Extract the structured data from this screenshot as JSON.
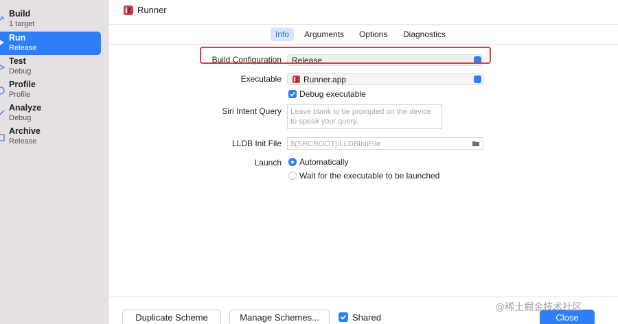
{
  "sidebar": {
    "items": [
      {
        "title": "Build",
        "subtitle": "1 target"
      },
      {
        "title": "Run",
        "subtitle": "Release"
      },
      {
        "title": "Test",
        "subtitle": "Debug"
      },
      {
        "title": "Profile",
        "subtitle": "Profile"
      },
      {
        "title": "Analyze",
        "subtitle": "Debug"
      },
      {
        "title": "Archive",
        "subtitle": "Release"
      }
    ]
  },
  "window": {
    "title": "Runner"
  },
  "tabs": [
    {
      "label": "Info"
    },
    {
      "label": "Arguments"
    },
    {
      "label": "Options"
    },
    {
      "label": "Diagnostics"
    }
  ],
  "form": {
    "build_configuration": {
      "label": "Build Configuration",
      "value": "Release"
    },
    "executable": {
      "label": "Executable",
      "value": "Runner.app"
    },
    "debug_executable": {
      "label": "Debug executable",
      "checked": true
    },
    "siri_intent_query": {
      "label": "Siri Intent Query",
      "placeholder": "Leave blank to be prompted on the device to speak your query."
    },
    "lldb_init_file": {
      "label": "LLDB Init File",
      "placeholder": "$(SRCROOT)/LLDBInitFile"
    },
    "launch": {
      "label": "Launch",
      "options": [
        {
          "label": "Automatically",
          "selected": true
        },
        {
          "label": "Wait for the executable to be launched",
          "selected": false
        }
      ]
    }
  },
  "footer": {
    "duplicate_label": "Duplicate Scheme",
    "manage_label": "Manage Schemes...",
    "shared_label": "Shared",
    "close_label": "Close"
  },
  "watermark": "@稀土掘金技术社区",
  "colors": {
    "accent": "#2e7ff6",
    "highlight": "#e53935",
    "sidebar_bg": "#e4e0e3"
  }
}
